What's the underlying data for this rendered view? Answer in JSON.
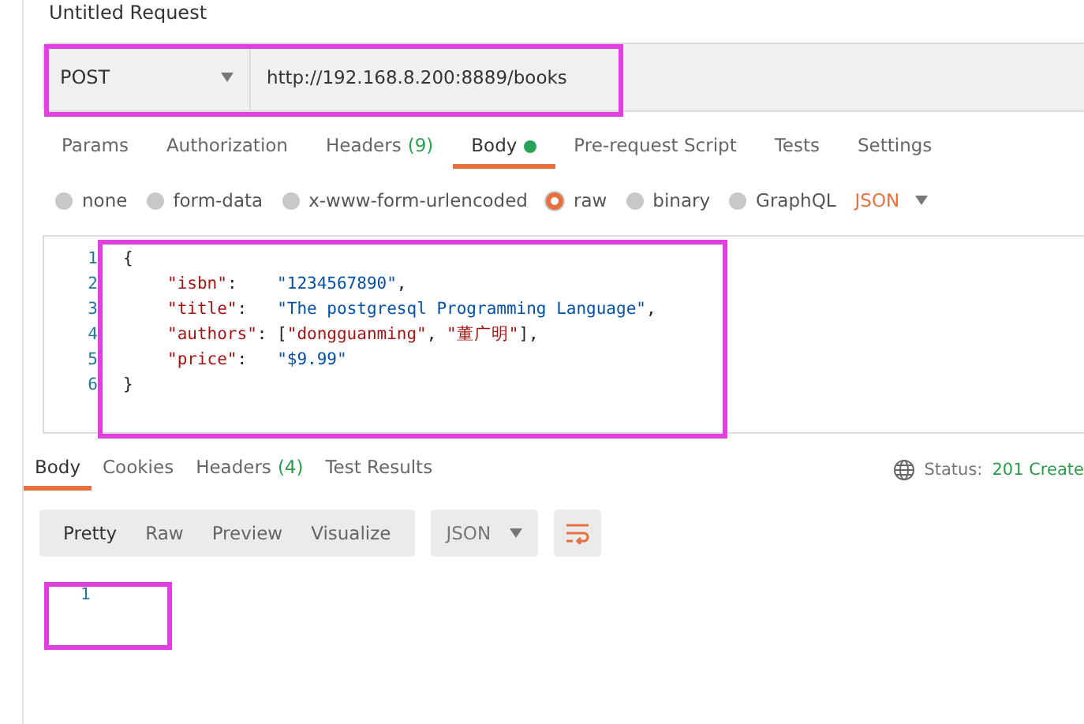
{
  "request_title": "Untitled Request",
  "request": {
    "method": "POST",
    "url": "http://192.168.8.200:8889/books"
  },
  "request_tabs": [
    {
      "label": "Params",
      "selected": false
    },
    {
      "label": "Authorization",
      "selected": false
    },
    {
      "label": "Headers",
      "count": "(9)",
      "selected": false
    },
    {
      "label": "Body",
      "dot": true,
      "selected": true
    },
    {
      "label": "Pre-request Script",
      "selected": false
    },
    {
      "label": "Tests",
      "selected": false
    },
    {
      "label": "Settings",
      "selected": false
    }
  ],
  "body_types": [
    {
      "label": "none",
      "selected": false
    },
    {
      "label": "form-data",
      "selected": false
    },
    {
      "label": "x-www-form-urlencoded",
      "selected": false
    },
    {
      "label": "raw",
      "selected": true
    },
    {
      "label": "binary",
      "selected": false
    },
    {
      "label": "GraphQL",
      "selected": false
    }
  ],
  "body_format": "JSON",
  "editor_lines": [
    {
      "number": "1",
      "tokens": [
        {
          "kind": "punct",
          "text": "{"
        }
      ]
    },
    {
      "number": "2",
      "indented": true,
      "tokens": [
        {
          "kind": "key",
          "text": "\"isbn\""
        },
        {
          "kind": "punct",
          "text": ":    "
        },
        {
          "kind": "string",
          "text": "\"1234567890\""
        },
        {
          "kind": "punct",
          "text": ","
        }
      ]
    },
    {
      "number": "3",
      "indented": true,
      "tokens": [
        {
          "kind": "key",
          "text": "\"title\""
        },
        {
          "kind": "punct",
          "text": ":   "
        },
        {
          "kind": "string",
          "text": "\"The postgresql Programming Language\""
        },
        {
          "kind": "punct",
          "text": ","
        }
      ]
    },
    {
      "number": "4",
      "indented": true,
      "tokens": [
        {
          "kind": "key",
          "text": "\"authors\""
        },
        {
          "kind": "punct",
          "text": ": ["
        },
        {
          "kind": "key",
          "text": "\"dongguanming\""
        },
        {
          "kind": "punct",
          "text": ", "
        },
        {
          "kind": "key",
          "text": "\"董广明\""
        },
        {
          "kind": "punct",
          "text": "],"
        }
      ]
    },
    {
      "number": "5",
      "indented": true,
      "tokens": [
        {
          "kind": "key",
          "text": "\"price\""
        },
        {
          "kind": "punct",
          "text": ":   "
        },
        {
          "kind": "string",
          "text": "\"$9.99\""
        }
      ]
    },
    {
      "number": "6",
      "tokens": [
        {
          "kind": "punct",
          "text": "}"
        }
      ]
    }
  ],
  "response_tabs": [
    {
      "label": "Body",
      "selected": true
    },
    {
      "label": "Cookies",
      "selected": false
    },
    {
      "label": "Headers",
      "count": "(4)",
      "selected": false
    },
    {
      "label": "Test Results",
      "selected": false
    }
  ],
  "status": {
    "label": "Status:",
    "value": "201 Create"
  },
  "view_modes": [
    {
      "label": "Pretty",
      "selected": true
    },
    {
      "label": "Raw",
      "selected": false
    },
    {
      "label": "Preview",
      "selected": false
    },
    {
      "label": "Visualize",
      "selected": false
    }
  ],
  "response_format": "JSON",
  "response_lines": [
    "1"
  ]
}
